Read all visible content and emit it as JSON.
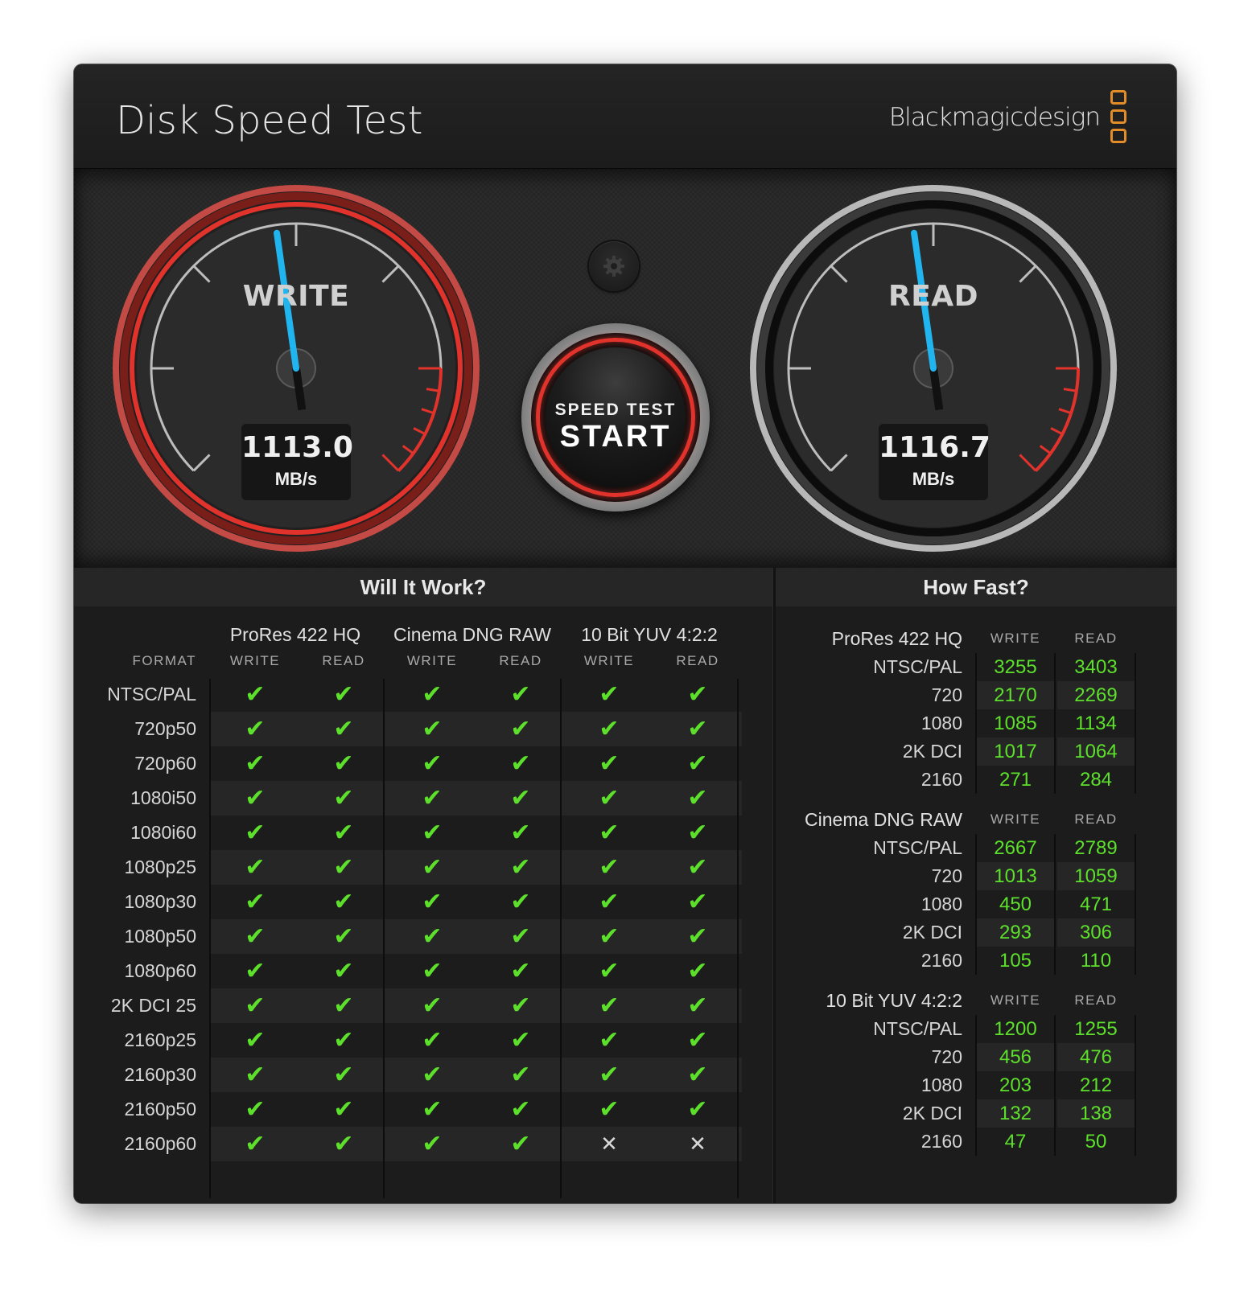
{
  "window": {
    "close_glyph": "×",
    "title": "Disk Speed Test",
    "brand": "Blackmagicdesign",
    "brand_color": "#e38d28"
  },
  "gauges": {
    "write": {
      "label": "WRITE",
      "value": "1113.0",
      "unit": "MB/s",
      "needle_fraction": 0.47,
      "accent": "#e1332b"
    },
    "read": {
      "label": "READ",
      "value": "1116.7",
      "unit": "MB/s",
      "needle_fraction": 0.47,
      "accent": "#9a9a9a"
    }
  },
  "controls": {
    "settings_icon": "gear-icon",
    "start_small": "SPEED TEST",
    "start_big": "START"
  },
  "will_it_work": {
    "title": "Will It Work?",
    "format_header": "FORMAT",
    "groups": [
      "ProRes 422 HQ",
      "Cinema DNG RAW",
      "10 Bit YUV 4:2:2"
    ],
    "subcols": [
      "WRITE",
      "READ"
    ],
    "ok_glyph": "✔",
    "no_glyph": "✕",
    "ok_color": "#5de02b",
    "rows": [
      {
        "label": "NTSC/PAL",
        "cells": [
          true,
          true,
          true,
          true,
          true,
          true
        ]
      },
      {
        "label": "720p50",
        "cells": [
          true,
          true,
          true,
          true,
          true,
          true
        ]
      },
      {
        "label": "720p60",
        "cells": [
          true,
          true,
          true,
          true,
          true,
          true
        ]
      },
      {
        "label": "1080i50",
        "cells": [
          true,
          true,
          true,
          true,
          true,
          true
        ]
      },
      {
        "label": "1080i60",
        "cells": [
          true,
          true,
          true,
          true,
          true,
          true
        ]
      },
      {
        "label": "1080p25",
        "cells": [
          true,
          true,
          true,
          true,
          true,
          true
        ]
      },
      {
        "label": "1080p30",
        "cells": [
          true,
          true,
          true,
          true,
          true,
          true
        ]
      },
      {
        "label": "1080p50",
        "cells": [
          true,
          true,
          true,
          true,
          true,
          true
        ]
      },
      {
        "label": "1080p60",
        "cells": [
          true,
          true,
          true,
          true,
          true,
          true
        ]
      },
      {
        "label": "2K DCI 25",
        "cells": [
          true,
          true,
          true,
          true,
          true,
          true
        ]
      },
      {
        "label": "2160p25",
        "cells": [
          true,
          true,
          true,
          true,
          true,
          true
        ]
      },
      {
        "label": "2160p30",
        "cells": [
          true,
          true,
          true,
          true,
          true,
          true
        ]
      },
      {
        "label": "2160p50",
        "cells": [
          true,
          true,
          true,
          true,
          true,
          true
        ]
      },
      {
        "label": "2160p60",
        "cells": [
          true,
          true,
          true,
          true,
          false,
          false
        ]
      }
    ]
  },
  "how_fast": {
    "title": "How Fast?",
    "write_header": "WRITE",
    "read_header": "READ",
    "groups": [
      {
        "name": "ProRes 422 HQ",
        "rows": [
          {
            "label": "NTSC/PAL",
            "write": "3255",
            "read": "3403"
          },
          {
            "label": "720",
            "write": "2170",
            "read": "2269"
          },
          {
            "label": "1080",
            "write": "1085",
            "read": "1134"
          },
          {
            "label": "2K DCI",
            "write": "1017",
            "read": "1064"
          },
          {
            "label": "2160",
            "write": "271",
            "read": "284"
          }
        ]
      },
      {
        "name": "Cinema DNG RAW",
        "rows": [
          {
            "label": "NTSC/PAL",
            "write": "2667",
            "read": "2789"
          },
          {
            "label": "720",
            "write": "1013",
            "read": "1059"
          },
          {
            "label": "1080",
            "write": "450",
            "read": "471"
          },
          {
            "label": "2K DCI",
            "write": "293",
            "read": "306"
          },
          {
            "label": "2160",
            "write": "105",
            "read": "110"
          }
        ]
      },
      {
        "name": "10 Bit YUV 4:2:2",
        "rows": [
          {
            "label": "NTSC/PAL",
            "write": "1200",
            "read": "1255"
          },
          {
            "label": "720",
            "write": "456",
            "read": "476"
          },
          {
            "label": "1080",
            "write": "203",
            "read": "212"
          },
          {
            "label": "2K DCI",
            "write": "132",
            "read": "138"
          },
          {
            "label": "2160",
            "write": "47",
            "read": "50"
          }
        ]
      }
    ]
  }
}
